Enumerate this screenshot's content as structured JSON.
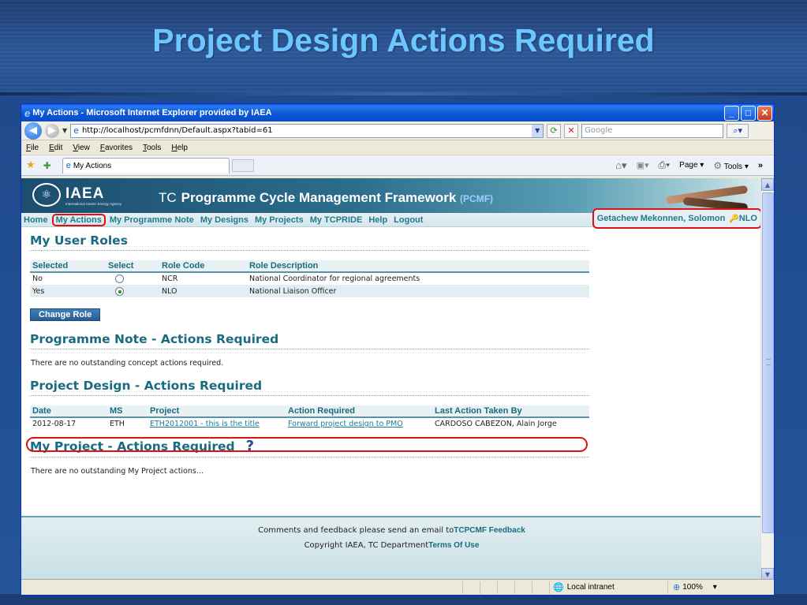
{
  "slide": {
    "title": "Project Design Actions Required"
  },
  "browser": {
    "window_title": "My Actions - Microsoft Internet Explorer provided by IAEA",
    "url": "http://localhost/pcmfdnn/Default.aspx?tabid=61",
    "search_placeholder": "Google",
    "menu": [
      "File",
      "Edit",
      "View",
      "Favorites",
      "Tools",
      "Help"
    ],
    "tab_label": "My Actions",
    "page_label": "Page",
    "tools_label": "Tools",
    "status_zone": "Local intranet",
    "zoom": "100%"
  },
  "site": {
    "logo": "IAEA",
    "logo_sub": "International Atomic Energy Agency",
    "title_prefix": "TC",
    "title_main": "Programme Cycle Management Framework",
    "title_abbr": "(PCMF)",
    "nav": [
      "Home",
      "My Actions",
      "My Programme Note",
      "My Designs",
      "My Projects",
      "My TCPRIDE",
      "Help",
      "Logout"
    ],
    "user": "Getachew Mekonnen, Solomon",
    "user_role": "NLO"
  },
  "roles": {
    "title": "My User Roles",
    "headers": [
      "Selected",
      "Select",
      "Role Code",
      "Role Description"
    ],
    "rows": [
      {
        "selected": "No",
        "checked": false,
        "code": "NCR",
        "description": "National Coordinator for regional agreements"
      },
      {
        "selected": "Yes",
        "checked": true,
        "code": "NLO",
        "description": "National Liaison Officer"
      }
    ],
    "button": "Change Role"
  },
  "programme_note": {
    "title": "Programme Note - Actions Required",
    "message": "There are no outstanding concept actions required."
  },
  "project_design": {
    "title": "Project Design - Actions Required",
    "headers": [
      "Date",
      "MS",
      "Project",
      "Action Required",
      "Last Action Taken By"
    ],
    "rows": [
      {
        "date": "2012-08-17",
        "ms": "ETH",
        "project": "ETH2012001 - this is the title",
        "action": "Forward project design to PMO",
        "last_by": "CARDOSO CABEZON, Alain Jorge"
      }
    ]
  },
  "my_project": {
    "title": "My Project - Actions Required",
    "message": "There are no outstanding My Project actions..."
  },
  "footer": {
    "line1": "Comments and feedback please send an email to",
    "line1_link": "TCPCMF Feedback",
    "line2": "Copyright IAEA, TC Department",
    "line2_link": "Terms Of Use"
  }
}
